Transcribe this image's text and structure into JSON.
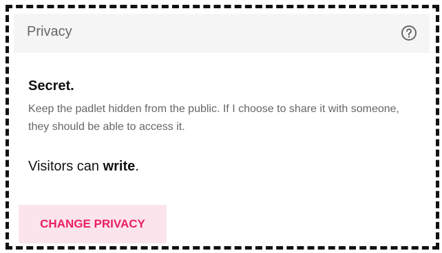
{
  "header": {
    "title": "Privacy",
    "help_icon": "help-circle-icon"
  },
  "privacy": {
    "level": "Secret",
    "level_suffix": ".",
    "description": "Keep the padlet hidden from the public. If I choose to share it with someone, they should be able to access it."
  },
  "visitors": {
    "prefix": "Visitors can ",
    "permission": "write",
    "suffix": "."
  },
  "actions": {
    "change_privacy_label": "CHANGE PRIVACY"
  },
  "colors": {
    "accent": "#e91e63",
    "accent_bg": "#fce4ec",
    "header_bg": "#f5f5f5"
  }
}
